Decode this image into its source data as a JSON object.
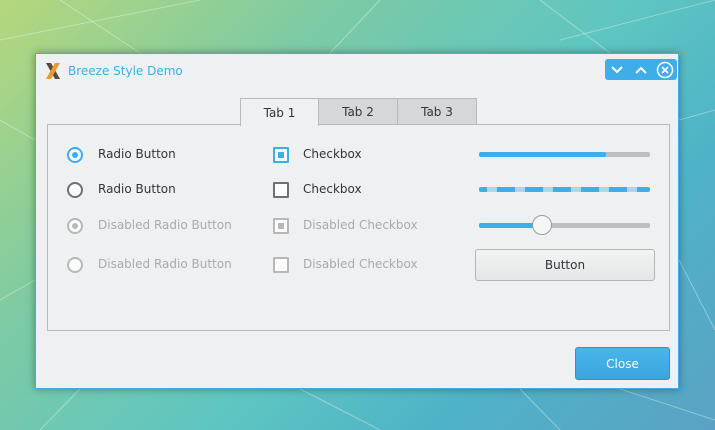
{
  "window": {
    "title": "Breeze Style Demo",
    "app_icon": "x-logo-icon",
    "controls": [
      "minimize-icon",
      "maximize-icon",
      "close-icon"
    ]
  },
  "tabs": [
    {
      "label": "Tab 1",
      "active": true
    },
    {
      "label": "Tab 2",
      "active": false
    },
    {
      "label": "Tab 3",
      "active": false
    }
  ],
  "radios": [
    {
      "label": "Radio Button",
      "checked": true,
      "disabled": false
    },
    {
      "label": "Radio Button",
      "checked": false,
      "disabled": false
    },
    {
      "label": "Disabled Radio Button",
      "checked": true,
      "disabled": true
    },
    {
      "label": "Disabled Radio Button",
      "checked": false,
      "disabled": true
    }
  ],
  "checkboxes": [
    {
      "label": "Checkbox",
      "checked": true,
      "disabled": false
    },
    {
      "label": "Checkbox",
      "checked": false,
      "disabled": false
    },
    {
      "label": "Disabled Checkbox",
      "checked": true,
      "disabled": true
    },
    {
      "label": "Disabled Checkbox",
      "checked": false,
      "disabled": true
    }
  ],
  "progress": {
    "value_percent": 74
  },
  "busy_indicator": {
    "state": "busy"
  },
  "slider": {
    "value_percent": 37
  },
  "button": {
    "label": "Button"
  },
  "footer": {
    "close_label": "Close"
  },
  "colors": {
    "accent": "#3daee9",
    "window_bg": "#eff0f1",
    "text": "#31363b",
    "disabled_text": "#a8aaab"
  }
}
